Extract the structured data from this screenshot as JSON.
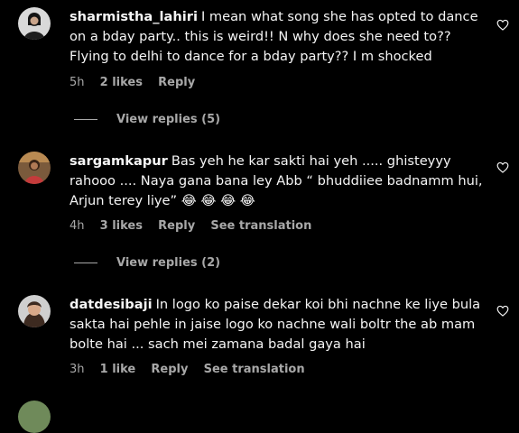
{
  "colors": {
    "background": "#000000",
    "text": "#f5f5f5",
    "secondary": "#a8a8a8"
  },
  "comments": [
    {
      "username": "sharmistha_lahiri",
      "text": "I mean what song she has opted to dance on a bday party.. this is weird!! N why does she need to?? Flying to delhi to dance for a bday party?? I m shocked",
      "time": "5h",
      "likes": "2 likes",
      "reply": "Reply",
      "see_translation": "",
      "view_replies": "View replies (5)",
      "like_icon": "heart-outline-icon"
    },
    {
      "username": "sargamkapur",
      "text": "Bas yeh he kar sakti hai yeh ..... ghisteyyy rahooo .... Naya gana bana ley Abb “ bhuddiiee badnamm hui, Arjun terey liye” 😂 😂 😂 😂",
      "time": "4h",
      "likes": "3 likes",
      "reply": "Reply",
      "see_translation": "See translation",
      "view_replies": "View replies (2)",
      "like_icon": "heart-outline-icon"
    },
    {
      "username": "datdesibaji",
      "text": "In logo ko paise dekar koi bhi nachne ke liye bula sakta hai pehle in jaise logo ko nachne wali boltr the ab mam bolte hai ... sach mei zamana badal gaya hai",
      "time": "3h",
      "likes": "1 like",
      "reply": "Reply",
      "see_translation": "See translation",
      "view_replies": "",
      "like_icon": "heart-outline-icon"
    }
  ]
}
